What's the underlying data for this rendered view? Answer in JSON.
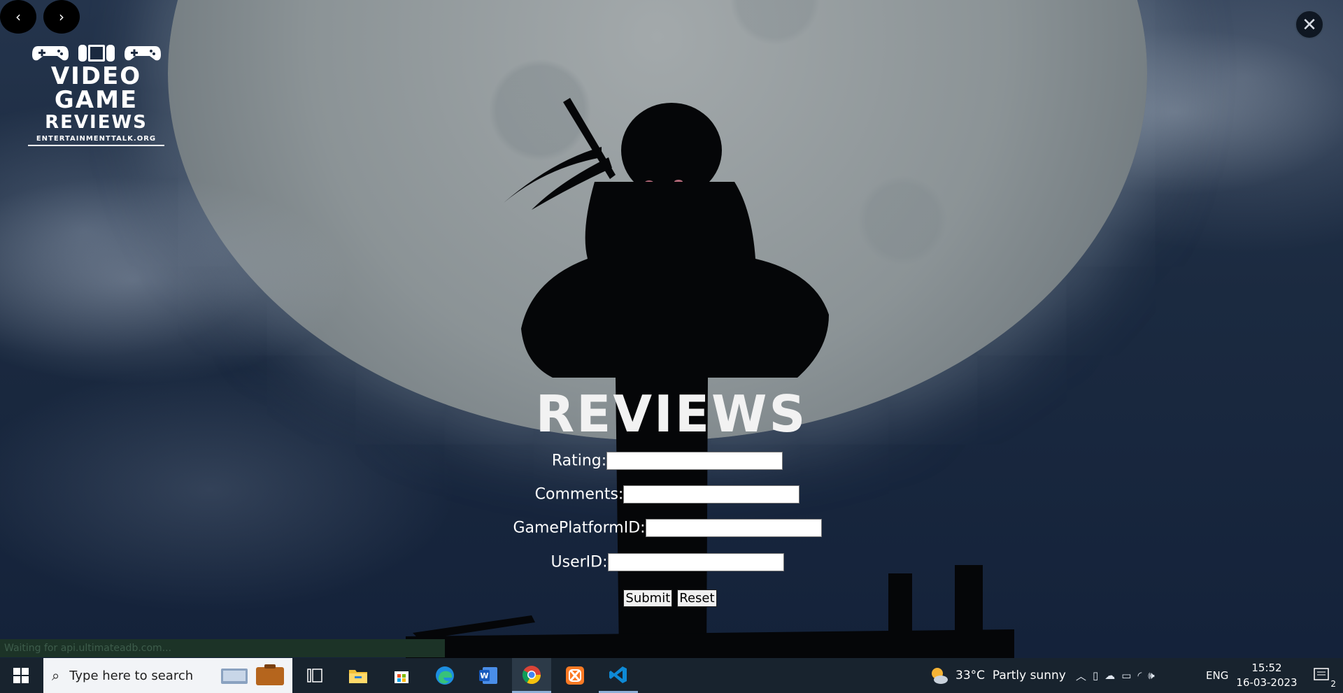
{
  "nav": {
    "prev_label": "‹",
    "next_label": "›",
    "close_label": "✕"
  },
  "logo": {
    "line1": "VIDEO",
    "line2": "GAME",
    "line3": "REVIEWS",
    "line4": "ENTERTAINMENTTALK.ORG"
  },
  "form": {
    "title": "REVIEWS",
    "fields": [
      {
        "label": "Rating:",
        "value": ""
      },
      {
        "label": "Comments:",
        "value": ""
      },
      {
        "label": "GamePlatformID:",
        "value": ""
      },
      {
        "label": "UserID:",
        "value": ""
      }
    ],
    "submit_label": "Submit",
    "reset_label": "Reset"
  },
  "status_bar": {
    "text": "Waiting for api.ultimateadb.com..."
  },
  "taskbar": {
    "search_placeholder": "Type here to search",
    "weather_temp": "33°C",
    "weather_desc": "Partly sunny",
    "language": "ENG",
    "time": "15:52",
    "date": "16-03-2023",
    "notification_count": "2",
    "apps": [
      "start-icon",
      "task-view-icon",
      "file-explorer-icon",
      "microsoft-store-icon",
      "edge-icon",
      "word-icon",
      "chrome-icon",
      "xampp-icon",
      "vscode-icon"
    ]
  },
  "colors": {
    "taskbar_bg": "#18232e",
    "status_bg": "#1c3327",
    "moon": "#8b9396"
  }
}
